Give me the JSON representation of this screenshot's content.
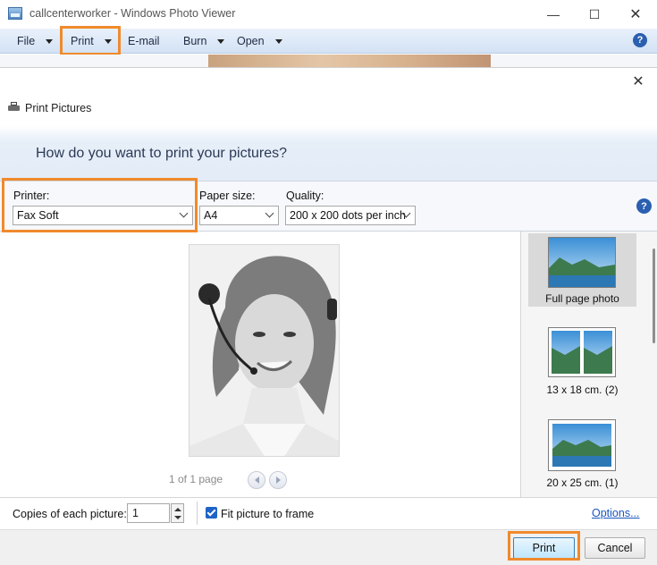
{
  "window": {
    "title": "callcenterworker - Windows Photo Viewer",
    "minimize_glyph": "—",
    "maximize_glyph": "☐",
    "close_glyph": "✕"
  },
  "menu": {
    "items": [
      {
        "label": "File",
        "has_dropdown": true
      },
      {
        "label": "Print",
        "has_dropdown": true
      },
      {
        "label": "E-mail",
        "has_dropdown": false
      },
      {
        "label": "Burn",
        "has_dropdown": true
      },
      {
        "label": "Open",
        "has_dropdown": true
      }
    ],
    "help_glyph": "?"
  },
  "dialog": {
    "title": "Print Pictures",
    "close_glyph": "✕",
    "heading": "How do you want to print your pictures?",
    "printer": {
      "label": "Printer:",
      "value": "Fax Soft"
    },
    "paper_size": {
      "label": "Paper size:",
      "value": "A4"
    },
    "quality": {
      "label": "Quality:",
      "value": "200 x 200 dots per inch"
    },
    "help_glyph": "?",
    "pager": "1 of 1 page",
    "layouts": [
      {
        "label": "Full page photo",
        "selected": true
      },
      {
        "label": "13 x 18 cm. (2)",
        "selected": false
      },
      {
        "label": "20 x 25 cm. (1)",
        "selected": false
      }
    ],
    "copies": {
      "label": "Copies of each picture:",
      "value": "1"
    },
    "fit": {
      "label": "Fit picture to frame",
      "checked": true
    },
    "options_link": "Options...",
    "print_button": "Print",
    "cancel_button": "Cancel"
  },
  "colors": {
    "highlight": "#f08a2c",
    "accent": "#2b5fb0",
    "link": "#1a55c2"
  }
}
